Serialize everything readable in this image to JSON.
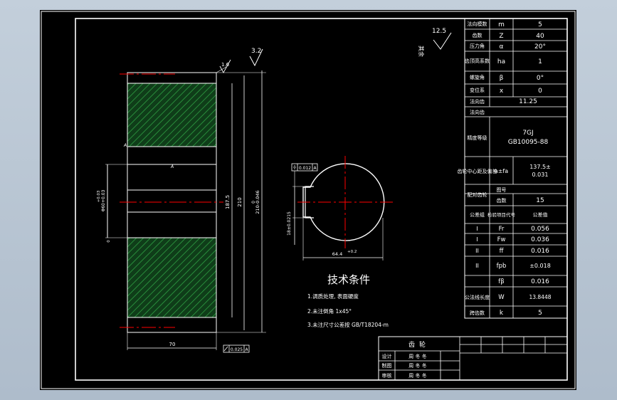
{
  "colors": {
    "background": "#000000",
    "line": "#ffffff",
    "centerline": "#ff0000",
    "hatch": "#2ea043",
    "viewport": "#b9c6d4"
  },
  "roughness": {
    "general": "12.5",
    "general_note": "其余",
    "face": "3.2",
    "bore": "1.6"
  },
  "section_view": {
    "hub_dim": "70",
    "diameter_1": "187.5",
    "diameter_2": "210",
    "tip_tol_top": "0",
    "tip_dim": "210-0.046",
    "bore_dim": "Φ60+0.03",
    "bore_tol": "+0.03",
    "key_tol": "0",
    "angle_mark_1": "A",
    "angle_mark_2": "A",
    "runout": "0.025",
    "runout_datum": "A",
    "chamfer_mark": "A"
  },
  "end_view": {
    "symmetry": "0.012",
    "symmetry_datum": "A",
    "keyway_width": "18±0.0215",
    "keyway_depth": "64.4",
    "keyway_tol": "+0.2"
  },
  "tech_req": {
    "title": "技术条件",
    "items": [
      "1.调质处理, 表面硬度",
      "2.未注倒角 1x45°",
      "3.未注尺寸公差按 GB/T18204-m"
    ]
  },
  "gear_table": {
    "rows": [
      {
        "label": "法向模数",
        "sym": "m",
        "val": "5"
      },
      {
        "label": "齿数",
        "sym": "Z",
        "val": "40"
      },
      {
        "label": "压力角",
        "sym": "α",
        "val": "20°"
      },
      {
        "label": "齿顶高系数",
        "sym": "ha",
        "val": "1"
      },
      {
        "label": "螺旋角",
        "sym": "β",
        "val": "0°"
      },
      {
        "label": "变位系",
        "sym": "x",
        "val": "0"
      },
      {
        "label": "法向齿",
        "sym": "",
        "val": "11.25"
      },
      {
        "label": "法向齿",
        "sym": "",
        "val": ""
      }
    ],
    "precision_label": "精度等级",
    "precision_val1": "7GJ",
    "precision_val2": "GB10095-88",
    "center_label": "齿轮中心距及偏差",
    "center_sym": "a±fa",
    "center_val1": "137.5±",
    "center_val2": "0.031",
    "mate_label": "配对齿轮",
    "mate_sym": "图号",
    "mate_teeth_label": "齿数",
    "mate_teeth": "15",
    "group_label": "公差组",
    "check_label": "检验项目代号",
    "tol_label": "公差值",
    "tol_rows": [
      {
        "grp": "I",
        "sym": "Fr",
        "val": "0.056"
      },
      {
        "grp": "I",
        "sym": "Fw",
        "val": "0.036"
      },
      {
        "grp": "II",
        "sym": "ff",
        "val": "0.016"
      },
      {
        "grp": "II",
        "sym": "fpb",
        "val": "±0.018"
      },
      {
        "grp": "",
        "sym": "fβ",
        "val": "0.016"
      }
    ],
    "wn_label": "公法线长度",
    "wn_sym": "W",
    "wn_val": "13.8448",
    "k_label": "跨齿数",
    "k_sym": "k",
    "k_val": "5"
  },
  "title_block": {
    "part_name": "齿轮",
    "rows": [
      {
        "role": "设计",
        "name": "周 冬 冬"
      },
      {
        "role": "制图",
        "name": "周 冬 冬"
      },
      {
        "role": "审核",
        "name": "周 冬 冬"
      }
    ]
  }
}
